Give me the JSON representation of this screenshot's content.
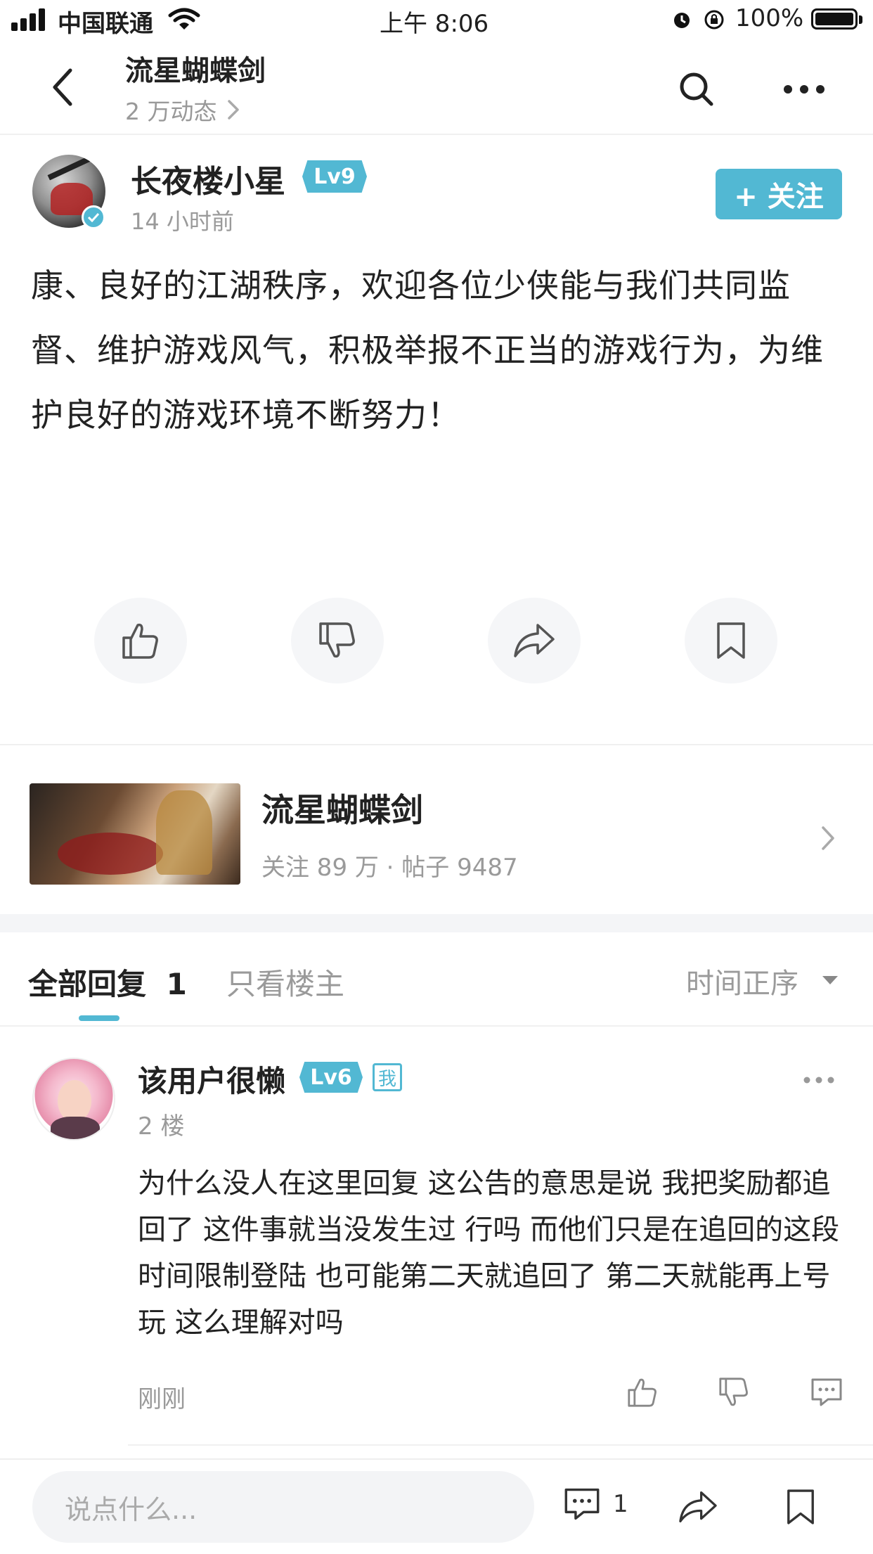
{
  "status_bar": {
    "carrier": "中国联通",
    "time": "上午 8:06",
    "battery": "100%"
  },
  "header": {
    "title": "流星蝴蝶剑",
    "subtitle": "2 万动态"
  },
  "post": {
    "author_name": "长夜楼小星",
    "author_level": "Lv9",
    "time": "14 小时前",
    "follow_label": "+ 关注",
    "body": "康、良好的江湖秩序，欢迎各位少侠能与我们共同监督、维护游戏风气，积极举报不正当的游戏行为，为维护良好的游戏环境不断努力！"
  },
  "community": {
    "name": "流星蝴蝶剑",
    "stats": "关注 89 万 · 帖子 9487"
  },
  "tabs": {
    "all_replies": "全部回复",
    "reply_count": "1",
    "owner_only": "只看楼主",
    "sort": "时间正序"
  },
  "reply": {
    "user_name": "该用户很懒",
    "user_level": "Lv6",
    "me_tag": "我",
    "floor": "2 楼",
    "text": "为什么没人在这里回复 这公告的意思是说 我把奖励都追回了 这件事就当没发生过 行吗 而他们只是在追回的这段时间限制登陆 也可能第二天就追回了 第二天就能再上号玩 这么理解对吗",
    "time": "刚刚"
  },
  "bottom_bar": {
    "input_placeholder": "说点什么...",
    "comment_count": "1"
  },
  "colors": {
    "accent": "#52b8d3",
    "muted": "#9a9a9a",
    "divider": "#f4f5f7"
  }
}
